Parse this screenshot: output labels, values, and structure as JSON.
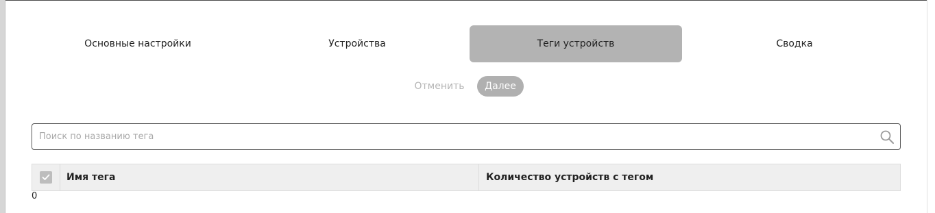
{
  "wizard": {
    "steps": [
      {
        "label": "Основные настройки",
        "active": false
      },
      {
        "label": "Устройства",
        "active": false
      },
      {
        "label": "Теги устройств",
        "active": true
      },
      {
        "label": "Сводка",
        "active": false
      }
    ],
    "cancel_label": "Отменить",
    "next_label": "Далее"
  },
  "search": {
    "placeholder": "Поиск по названию тега",
    "value": "",
    "icon": "search-icon"
  },
  "table": {
    "columns": [
      "Имя тега",
      "Количество устройств с тегом"
    ],
    "rows": [],
    "select_all_checked": true,
    "total_count": "0"
  },
  "colors": {
    "active_step_bg": "#b3b3b3",
    "next_button_bg": "#b0b0b0",
    "table_header_bg": "#efefef"
  }
}
